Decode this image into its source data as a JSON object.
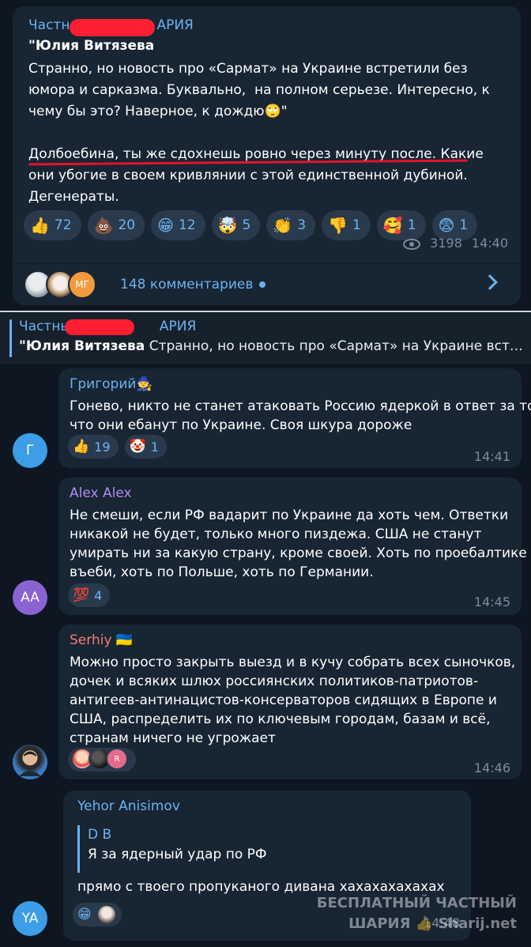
{
  "post": {
    "author_prefix": "Частн",
    "author_suffix": "АРИЯ",
    "quote_title": "\"Юлия Витязева",
    "text": "Странно, но новость про «Сармат» на Украине встретили без юмора и сарказма. Буквально,  на полном серьезе. Интересно, к чему бы это? Наверное, к дождю🙄\"\n\nДолбоебина, ты же сдохнешь ровно через минуту после. Какие они убогие в своем кривлянии с этой единственной дубиной. Дегенераты.",
    "reactions": [
      {
        "emoji": "👍",
        "count": "72"
      },
      {
        "emoji": "💩",
        "count": "20"
      },
      {
        "emoji": "😁",
        "count": "12"
      },
      {
        "emoji": "🤯",
        "count": "5"
      },
      {
        "emoji": "👏",
        "count": "3"
      },
      {
        "emoji": "👎",
        "count": "1"
      },
      {
        "emoji": "🥰",
        "count": "1"
      },
      {
        "emoji": "😨",
        "count": "1"
      }
    ],
    "views": "3198",
    "time": "14:40",
    "comments_label": "148 комментариев",
    "stack_avatar_label": "МГ"
  },
  "reply_header": {
    "name_prefix": "Частны",
    "name_suffix": "АРИЯ",
    "quote_author": "\"Юлия Витязева",
    "quote_text": " Странно, но новость про «Сармат» на Украине встретил..."
  },
  "comments": [
    {
      "name": "Григорий🧙",
      "name_color": "#6ab3f3",
      "avatar_letter": "Г",
      "avatar_color": "#3d9de6",
      "text": "Гонево, никто не станет атаковать Россию ядеркой в ответ за то\nчто они ебанут по Украине. Своя шкура дороже",
      "reactions": [
        {
          "emoji": "👍",
          "count": "19"
        },
        {
          "emoji": "🤡",
          "count": "1"
        }
      ],
      "time": "14:41"
    },
    {
      "name": "Alex Alex",
      "name_color": "#b38af5",
      "avatar_letter": "AA",
      "avatar_color": "#8a63d2",
      "text": "Не смеши, если РФ вадарит по Украине да хоть чем. Ответки\nникакой не будет, только много пиздежа. США не станут\nумирать ни за какую страну, кроме своей. Хоть по проебалтике\nвъеби, хоть по Польше, хоть по Германии.",
      "reactions": [
        {
          "emoji": "💯",
          "count": "4"
        }
      ],
      "time": "14:45"
    },
    {
      "name": "Serhiy 🇺🇦",
      "name_color": "#f27c75",
      "text": "Можно просто закрыть выезд и в кучу собрать всех сыночков,\nдочек и всяких шлюх россиянских политиков-патриотов-\nантигеев-антинацистов-консерваторов сидящих в Европе и\nСША, распределить их по ключевым городам, базам и всё,\nстранам ничего не угрожает",
      "reactors_badge": "R",
      "time": "14:46"
    },
    {
      "name": "Yehor Anisimov",
      "name_color": "#6ab3f3",
      "avatar_letter": "YA",
      "avatar_color": "#3d9de6",
      "quote_name": "D B",
      "quote_text": "Я за ядерный удар по РФ",
      "text": "прямо с твоего пропуканого дивана хахахахахахах",
      "reaction_emoji": "😁",
      "time": "14:48"
    }
  ],
  "watermark": {
    "line1": "БЕСПЛАТНЫЙ ЧАСТНЫЙ",
    "line2": "ШАРИЯ 👍 Sharij.net"
  }
}
